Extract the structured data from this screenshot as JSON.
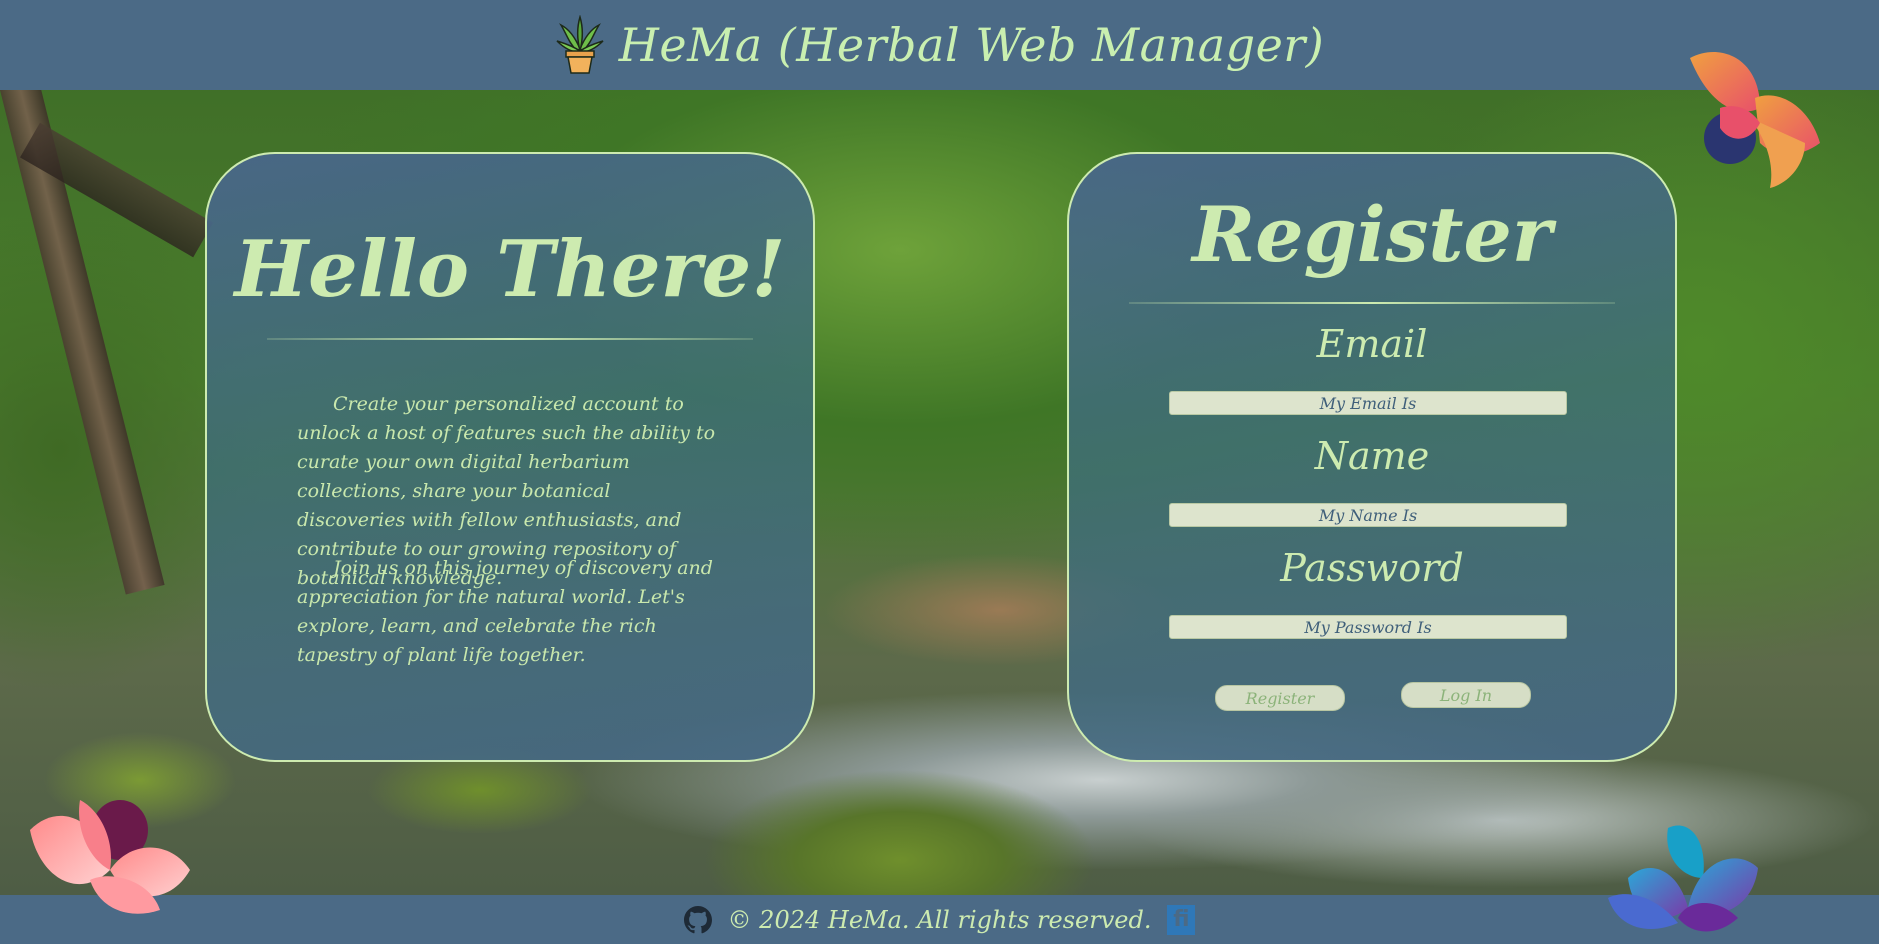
{
  "header": {
    "title": "HeMa (Herbal Web Manager)",
    "logo_icon": "potted-plant-icon"
  },
  "intro": {
    "title": "Hello There!",
    "paragraph1": "Create your personalized account to unlock a host of features such the ability to curate your own digital herbarium collections, share your botanical discoveries with fellow enthusiasts, and contribute to our growing repository of botanical knowledge.",
    "paragraph2": "Join us on this journey of discovery and appreciation for the natural world. Let's explore, learn, and celebrate the rich tapestry of plant life together."
  },
  "register": {
    "title": "Register",
    "email_label": "Email",
    "email_placeholder": "My Email Is",
    "name_label": "Name",
    "name_placeholder": "My Name Is",
    "password_label": "Password",
    "password_placeholder": "My Password Is",
    "register_button": "Register",
    "login_button": "Log In"
  },
  "footer": {
    "copyright": "© 2024 HeMa. All rights reserved.",
    "github_icon": "github-icon",
    "fi_icon": "fi-logo-icon"
  },
  "colors": {
    "bar": "#4b6a86",
    "accent_text": "#cdebb0",
    "panel": "#49668c"
  }
}
